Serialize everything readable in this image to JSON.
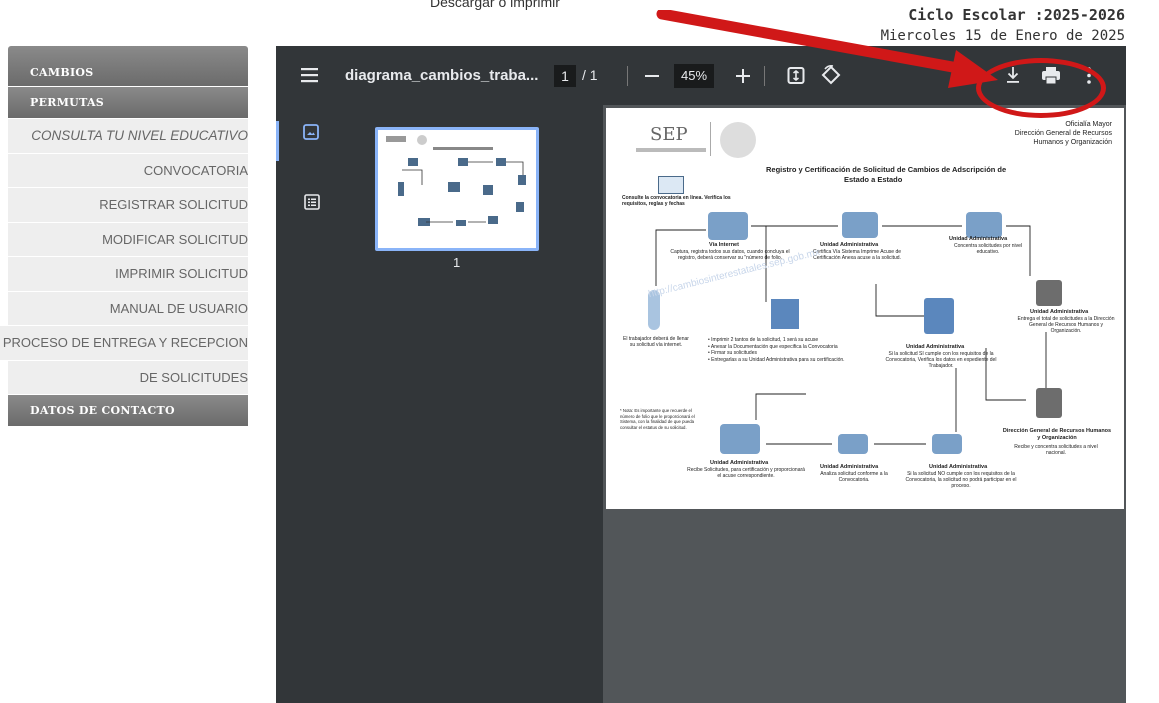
{
  "header": {
    "download_hint": "Descargar o imprimir",
    "ciclo": "Ciclo Escolar :2025-2026",
    "fecha": "Miercoles 15 de Enero de 2025"
  },
  "sidebar": {
    "items": [
      {
        "label": "CAMBIOS",
        "type": "dark"
      },
      {
        "label": "PERMUTAS",
        "type": "dark"
      },
      {
        "label": "CONSULTA TU NIVEL EDUCATIVO",
        "type": "light-italic"
      },
      {
        "label": "CONVOCATORIA",
        "type": "light"
      },
      {
        "label": "REGISTRAR SOLICITUD",
        "type": "light"
      },
      {
        "label": "MODIFICAR SOLICITUD",
        "type": "light"
      },
      {
        "label": "IMPRIMIR SOLICITUD",
        "type": "light"
      },
      {
        "label": "MANUAL DE USUARIO",
        "type": "light"
      },
      {
        "label": "PROCESO DE ENTREGA Y RECEPCION",
        "type": "light"
      },
      {
        "label": "DE SOLICITUDES",
        "type": "light"
      },
      {
        "label": "DATOS DE CONTACTO",
        "type": "dark"
      }
    ]
  },
  "viewer": {
    "filename": "diagrama_cambios_traba...",
    "page_current": "1",
    "page_total": "/ 1",
    "zoom": "45%",
    "thumb_page": "1",
    "icons": [
      "menu-icon",
      "zoom-out-icon",
      "zoom-in-icon",
      "fit-page-icon",
      "rotate-icon",
      "download-icon",
      "print-icon",
      "more-icon",
      "thumbnail-icon",
      "outline-icon"
    ]
  },
  "document": {
    "sep_logo": "SEP",
    "org_line1": "Oficialía Mayor",
    "org_line2": "Dirección General de Recursos",
    "org_line3": "Humanos y Organización",
    "title_line1": "Registro y Certificación de Solicitud de Cambios de Adscripción de",
    "title_line2": "Estado a Estado",
    "consulta": "Consulte la convocatoria en línea. Verifica los requisitos, reglas y fechas",
    "via_internet_title": "Vía Internet",
    "via_internet_text": "Captura, registra todos sus datos, cuando concluya el registro, deberá conservar su \"número de folio.",
    "ua1_title": "Unidad Administrativa",
    "ua1_text": "Certifica Vía Sistema Imprime Acuse de Certificación Anexa acuse a la solicitud.",
    "ua2_title": "Unidad Administrativa",
    "ua2_text": "Concentra solicitudes por nivel educativo.",
    "ua3_title": "Unidad Administrativa",
    "ua3_text": "Entrega el total de solicitudes a la Dirección General de Recursos Humanos y Organización.",
    "trabajador": "El trabajador deberá de llenar su solicitud vía internet.",
    "bullets": [
      "Imprimir 2 tantos de la solicitud, 1 será su acuse",
      "Anexar la Documentación que especifica la Convocatoria",
      "Firmar su solicitudes",
      "Entregarlas a su Unidad Administrativa para su certificación."
    ],
    "ua4_title": "Unidad Administrativa",
    "ua4_text": "Si la solicitud SI cumple con los requisitos de la Convocatoria, Verifica los datos en expediente del Trabajador.",
    "nota": "* Nota: Es importante que recuerde el número de folio que le proporcionará el Sistema, con la finalidad de que pueda consultar el estatus de su solicitud.",
    "ua5_title": "Unidad Administrativa",
    "ua5_text": "Recibe Solicitudes, para certificación y proporcionará el acuse correspondiente.",
    "ua6_title": "Unidad Administrativa",
    "ua6_text": "Analiza solicitud conforme a la Convocatoria.",
    "ua7_title": "Unidad Administrativa",
    "ua7_text": "Si la solicitud NO cumple con los requisitos de la Convocatoria, la solicitud no podrá participar en el proceso.",
    "dg_title": "Dirección General de Recursos Humanos y Organización",
    "dg_text": "Recibe y concentra solicitudes a nivel nacional.",
    "watermark": "http://cambiosinterestatales.sep.gob.mx"
  },
  "colors": {
    "annotation": "#d01818",
    "toolbar": "#323639",
    "viewer_bg": "#525659",
    "accent": "#8ab4f8"
  }
}
